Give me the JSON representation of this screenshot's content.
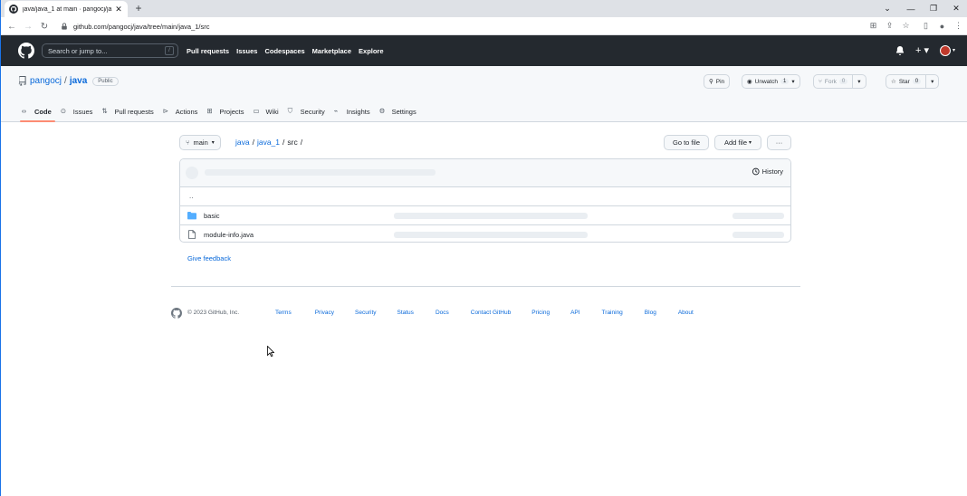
{
  "browser": {
    "tab_title": "java/java_1 at main · pangocj/ja",
    "url": "github.com/pangocj/java/tree/main/java_1/src",
    "icons": [
      "back-icon",
      "forward-icon",
      "reload-icon",
      "lock-icon",
      "translate-icon",
      "share-icon",
      "star-icon",
      "sidepanel-icon",
      "profile-icon",
      "menu-icon"
    ]
  },
  "gh_header": {
    "search_placeholder": "Search or jump to...",
    "search_key": "/",
    "nav": [
      "Pull requests",
      "Issues",
      "Codespaces",
      "Marketplace",
      "Explore"
    ]
  },
  "repo": {
    "owner": "pangocj",
    "separator": "/",
    "name": "java",
    "visibility": "Public",
    "pin_label": "Pin",
    "watch_label": "Unwatch",
    "watch_count": "1",
    "fork_label": "Fork",
    "fork_count": "0",
    "star_label": "Star",
    "star_count": "0",
    "tabs": [
      {
        "label": "Code",
        "icon": "code-icon"
      },
      {
        "label": "Issues",
        "icon": "issue-icon"
      },
      {
        "label": "Pull requests",
        "icon": "pull-request-icon"
      },
      {
        "label": "Actions",
        "icon": "play-icon"
      },
      {
        "label": "Projects",
        "icon": "table-icon"
      },
      {
        "label": "Wiki",
        "icon": "book-icon"
      },
      {
        "label": "Security",
        "icon": "shield-icon"
      },
      {
        "label": "Insights",
        "icon": "graph-icon"
      },
      {
        "label": "Settings",
        "icon": "gear-icon"
      }
    ]
  },
  "main": {
    "branch": "main",
    "crumbs": [
      "java",
      "/",
      "java_1",
      "/",
      "src",
      "/"
    ],
    "go_to_file": "Go to file",
    "add_file": "Add file",
    "more": "···",
    "history": "History",
    "parent_dir": "..",
    "files": [
      {
        "name": "basic",
        "type": "dir"
      },
      {
        "name": "module-info.java",
        "type": "file"
      }
    ],
    "feedback": "Give feedback"
  },
  "footer": {
    "copyright": "© 2023 GitHub, Inc.",
    "links": [
      "Terms",
      "Privacy",
      "Security",
      "Status",
      "Docs",
      "Contact GitHub",
      "Pricing",
      "API",
      "Training",
      "Blog",
      "About"
    ]
  }
}
